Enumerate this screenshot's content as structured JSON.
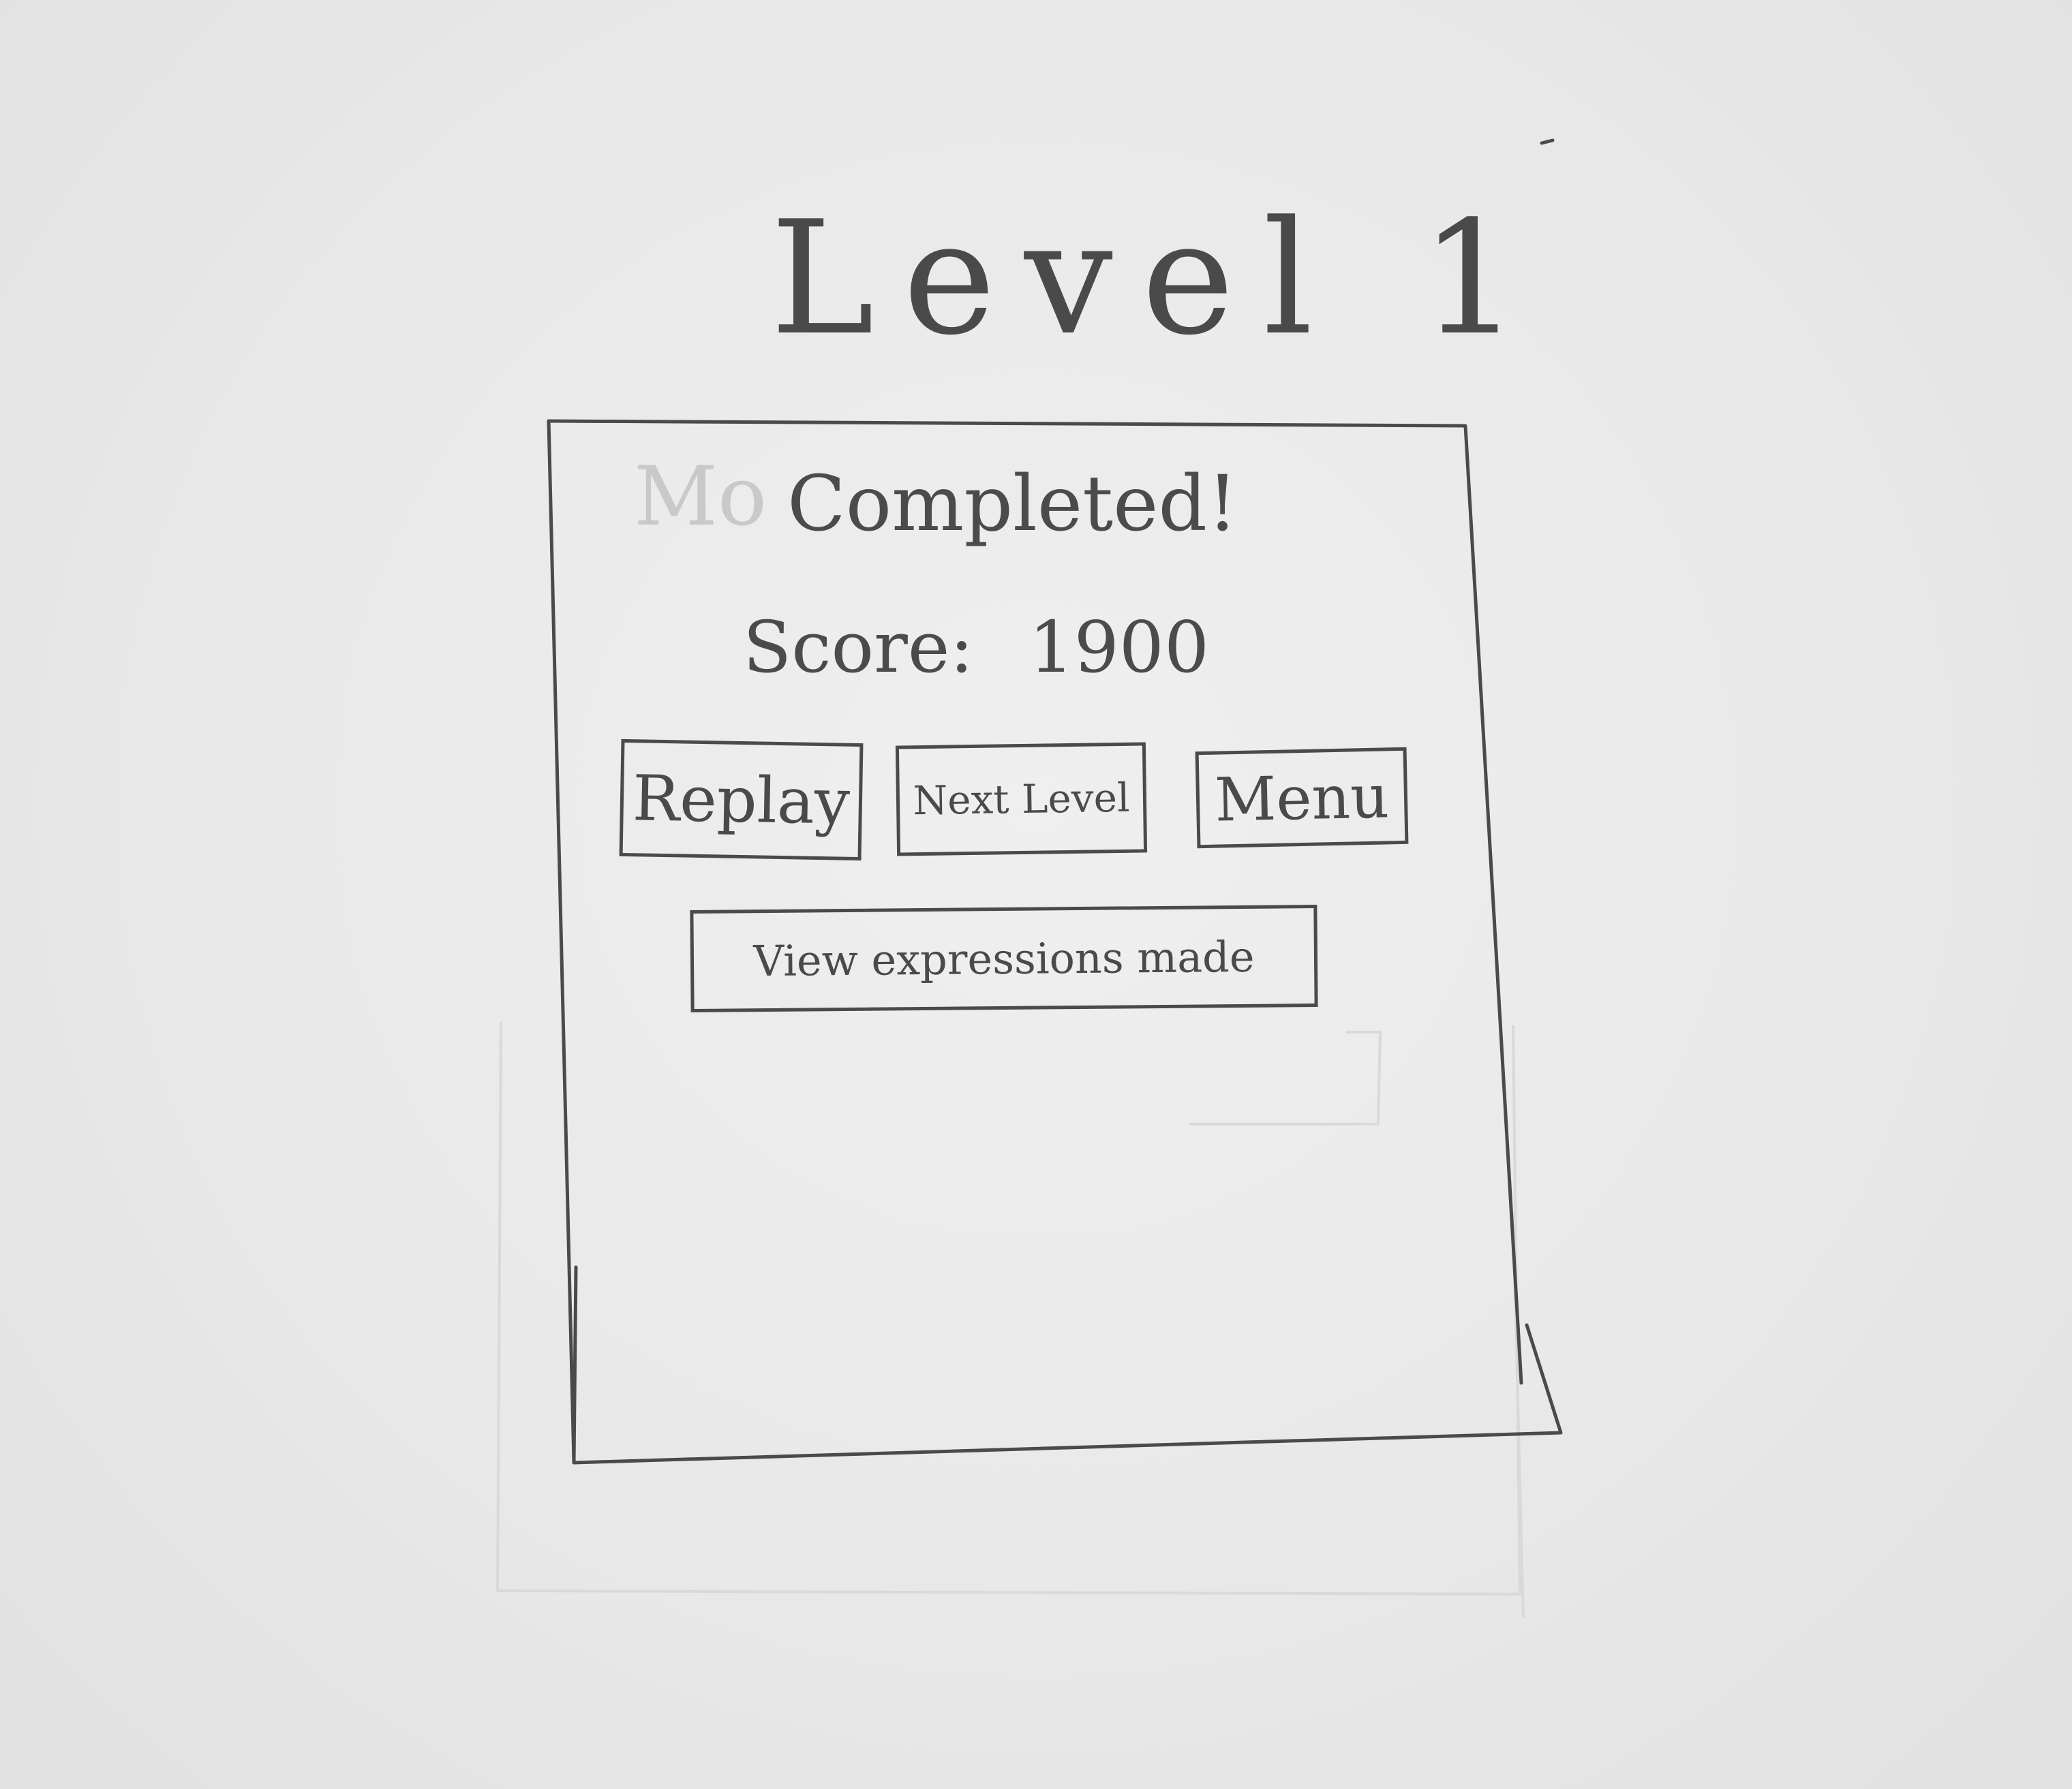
{
  "screen": {
    "title": "Level 1",
    "status": "Completed!",
    "score_label": "Score:",
    "score_value": "1900"
  },
  "buttons": {
    "replay": "Replay",
    "next_level": "Next Level",
    "menu": "Menu",
    "view_expressions": "View expressions made"
  },
  "ghost": {
    "moves_text": "Mo"
  },
  "colors": {
    "paper": "#e9e9e9",
    "ink": "#4a4a4a"
  }
}
